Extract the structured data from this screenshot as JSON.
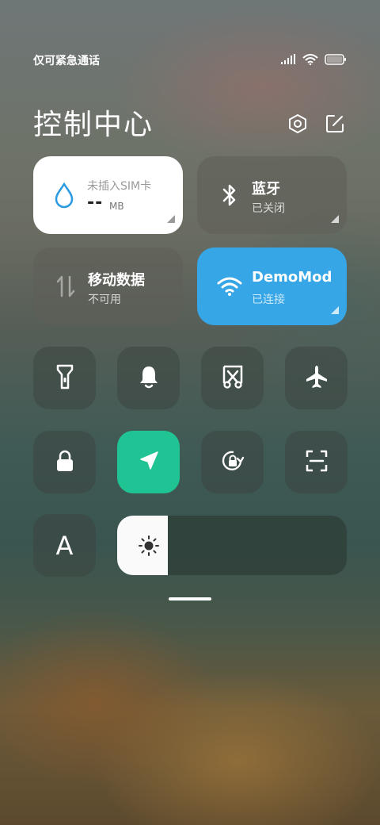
{
  "status_bar": {
    "carrier": "仅可紧急通话",
    "icons": [
      "signal-icon",
      "wifi-icon",
      "battery-icon"
    ]
  },
  "header": {
    "title": "控制中心",
    "buttons": [
      "settings-icon",
      "edit-icon"
    ]
  },
  "tiles": {
    "data_usage": {
      "label": "未插入SIM卡",
      "value": "--",
      "unit": "MB",
      "icon": "water-drop-icon"
    },
    "bluetooth": {
      "title": "蓝牙",
      "status": "已关闭",
      "icon": "bluetooth-icon"
    },
    "mobile_data": {
      "title": "移动数据",
      "status": "不可用",
      "icon": "arrows-updown-icon"
    },
    "wifi": {
      "title": "DemoMod",
      "status": "已连接",
      "icon": "wifi-icon"
    }
  },
  "toggles_row1": [
    "flashlight-icon",
    "bell-icon",
    "screenshot-icon",
    "airplane-icon"
  ],
  "toggles_row2": [
    "lock-icon",
    "location-icon",
    "rotation-lock-icon",
    "scan-icon"
  ],
  "font_button": {
    "label": "A"
  },
  "brightness": {
    "level": 0.22,
    "icon": "sun-icon"
  },
  "colors": {
    "accent_blue": "#36a6e6",
    "accent_green": "#20c393",
    "tile_light": "#ffffff"
  }
}
